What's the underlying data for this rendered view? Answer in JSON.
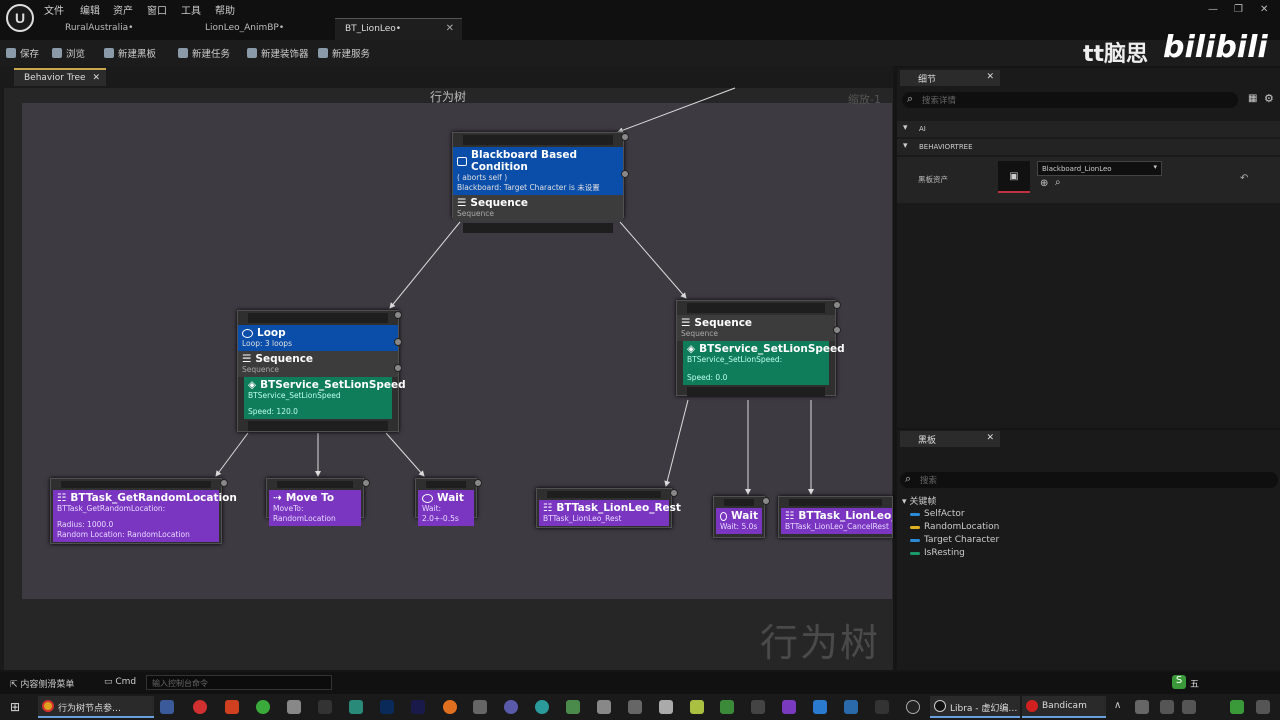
{
  "menu": [
    "文件",
    "编辑",
    "资产",
    "窗口",
    "工具",
    "帮助"
  ],
  "doc_tabs": [
    "RuralAustralia•",
    "LionLeo_AnimBP•",
    "BT_LionLeo•"
  ],
  "toolbar": {
    "save": "保存",
    "browse": "浏览",
    "new_blackboard": "新建黑板",
    "new_task": "新建任务",
    "new_decorator": "新建装饰器",
    "new_service": "新建服务"
  },
  "overlay": {
    "channel": "tt脑思",
    "brand": "bilibili"
  },
  "graph": {
    "tab": "Behavior Tree",
    "title": "行为树",
    "zoom": "缩放-1",
    "watermark": "行为树"
  },
  "nodes": {
    "bb_condition": {
      "title": "Blackboard Based Condition",
      "line1": "( aborts self )",
      "line2": "Blackboard: Target Character is 未设置"
    },
    "seq_root": {
      "title": "Sequence",
      "sub": "Sequence"
    },
    "loop": {
      "title": "Loop",
      "sub": "Loop: 3 loops"
    },
    "seq_left": {
      "title": "Sequence",
      "sub": "Sequence"
    },
    "svc_left": {
      "title": "BTService_SetLionSpeed",
      "sub": "BTService_SetLionSpeed",
      "val": "Speed: 120.0"
    },
    "seq_right": {
      "title": "Sequence",
      "sub": "Sequence"
    },
    "svc_right": {
      "title": "BTService_SetLionSpeed",
      "sub": "BTService_SetLionSpeed:",
      "val": "Speed: 0.0"
    },
    "get_rand": {
      "title": "BTTask_GetRandomLocation",
      "sub": "BTTask_GetRandomLocation:",
      "l1": "Radius: 1000.0",
      "l2": "Random Location: RandomLocation"
    },
    "moveto": {
      "title": "Move To",
      "sub": "MoveTo: RandomLocation"
    },
    "wait_left": {
      "title": "Wait",
      "sub": "Wait: 2.0+-0.5s"
    },
    "rest": {
      "title": "BTTask_LionLeo_Rest",
      "sub": "BTTask_LionLeo_Rest"
    },
    "wait_right": {
      "title": "Wait",
      "sub": "Wait: 5.0s"
    },
    "cancel": {
      "title": "BTTask_LionLeo_C",
      "sub": "BTTask_LionLeo_CancelRest"
    }
  },
  "details": {
    "tab": "细节",
    "search": "搜索详情",
    "sec_ai": "AI",
    "sec_bt": "BEHAVIORTREE",
    "asset_label": "黑板资产",
    "asset_value": "Blackboard_LionLeo"
  },
  "blackboard": {
    "tab": "黑板",
    "search": "搜索",
    "keys_header": "关键帧",
    "keys": [
      "SelfActor",
      "RandomLocation",
      "Target Character",
      "IsResting"
    ]
  },
  "key_colors": [
    "#2a8ad6",
    "#e0b020",
    "#2a8ad6",
    "#1a9a6a"
  ],
  "status": {
    "drawer": "内容侧滑菜单",
    "cmd": "Cmd",
    "cmd_placeholder": "输入控制台命令"
  },
  "taskbar": {
    "chrome": "行为树节点参…",
    "libra": "Libra - 虚幻编…",
    "bandicam": "Bandicam",
    "clock": "五"
  }
}
